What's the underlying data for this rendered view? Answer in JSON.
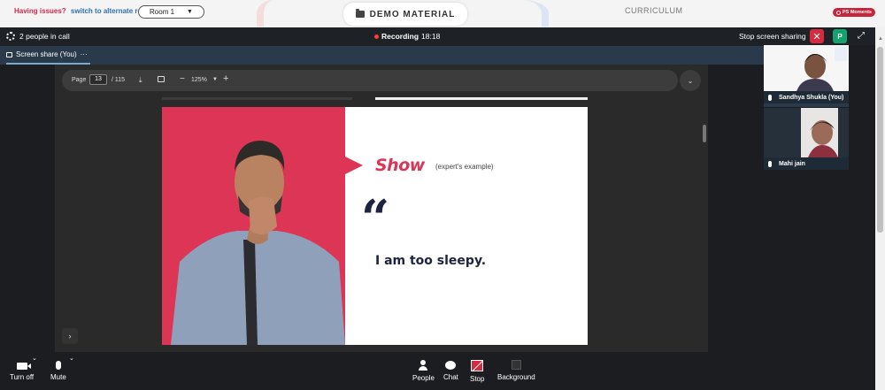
{
  "topbar": {
    "issues_text": "Having issues?",
    "alternate_link": "switch to alternate room",
    "room_value": "Room 1",
    "demo_tab": "DEMO MATERIAL",
    "curriculum_tab": "CURRICULUM",
    "moments_label": "PS Moments"
  },
  "call": {
    "people_count": "2 people in call",
    "recording_label": "Recording",
    "recording_time": "18:18",
    "stop_share_label": "Stop screen sharing",
    "stop_share_icon": "✕",
    "participant_initial": "P",
    "tab_label": "Screen share (You)",
    "tab_more": "···"
  },
  "pdf": {
    "page_label": "Page",
    "page_current": "13",
    "page_total": "/ 115",
    "zoom": "125%"
  },
  "slide": {
    "title": "Show",
    "subtitle": "(expert's example)",
    "quote_mark": "“",
    "quote": "I am too sleepy.",
    "accent_color": "#dd3556",
    "text_color": "#1d2340"
  },
  "participants": [
    {
      "name": "Sandhya Shukla (You)"
    },
    {
      "name": "Mahi jain"
    }
  ],
  "controls": {
    "turn_off": "Turn off",
    "mute": "Mute",
    "people": "People",
    "chat": "Chat",
    "stop": "Stop",
    "background": "Background"
  }
}
